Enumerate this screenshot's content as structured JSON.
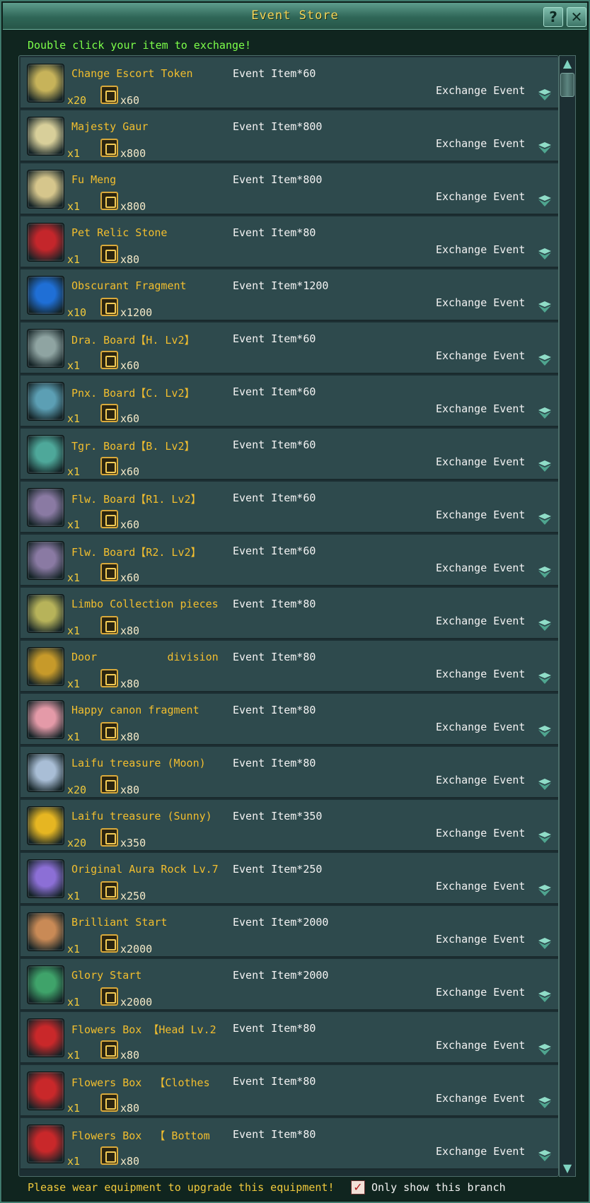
{
  "window": {
    "title": "Event Store",
    "help_label": "?",
    "close_label": "✕"
  },
  "hint": "Double click your item to exchange!",
  "currency_icon": "event-coin-icon",
  "exchange_label": "Exchange Event",
  "items": [
    {
      "name": "Change Escort Token",
      "qty": "x20",
      "price": "x60",
      "cost": "Event Item*60",
      "icon": "escort-token-icon",
      "icon_color": "#c7b35a"
    },
    {
      "name": "Majesty Gaur",
      "qty": "x1",
      "price": "x800",
      "cost": "Event Item*800",
      "icon": "gaur-mount-icon",
      "icon_color": "#d8cf9a"
    },
    {
      "name": "Fu Meng",
      "qty": "x1",
      "price": "x800",
      "cost": "Event Item*800",
      "icon": "fu-meng-mount-icon",
      "icon_color": "#d6c68c"
    },
    {
      "name": "Pet Relic Stone",
      "qty": "x1",
      "price": "x80",
      "cost": "Event Item*80",
      "icon": "relic-stone-icon",
      "icon_color": "#c4262b"
    },
    {
      "name": "Obscurant Fragment",
      "qty": "x10",
      "price": "x1200",
      "cost": "Event Item*1200",
      "icon": "blue-crystal-icon",
      "icon_color": "#1f6fd6"
    },
    {
      "name": "Dra. Board【H. Lv2】",
      "qty": "x1",
      "price": "x60",
      "cost": "Event Item*60",
      "icon": "board-book-icon",
      "icon_color": "#8fa4a2"
    },
    {
      "name": "Pnx. Board【C. Lv2】",
      "qty": "x1",
      "price": "x60",
      "cost": "Event Item*60",
      "icon": "board-book-icon",
      "icon_color": "#5c9fb4"
    },
    {
      "name": "Tgr. Board【B. Lv2】",
      "qty": "x1",
      "price": "x60",
      "cost": "Event Item*60",
      "icon": "board-book-icon",
      "icon_color": "#4ea89a"
    },
    {
      "name": "Flw. Board【R1. Lv2】",
      "qty": "x1",
      "price": "x60",
      "cost": "Event Item*60",
      "icon": "board-book-icon",
      "icon_color": "#8a7aa3"
    },
    {
      "name": "Flw. Board【R2. Lv2】",
      "qty": "x1",
      "price": "x60",
      "cost": "Event Item*60",
      "icon": "board-book-icon",
      "icon_color": "#8a7aa3"
    },
    {
      "name": "Limbo Collection pieces",
      "qty": "x1",
      "price": "x80",
      "cost": "Event Item*80",
      "icon": "leaf-pieces-icon",
      "icon_color": "#b7b35a"
    },
    {
      "name": "Door           division",
      "qty": "x1",
      "price": "x80",
      "cost": "Event Item*80",
      "icon": "golden-scroll-icon",
      "icon_color": "#c79a2a"
    },
    {
      "name": "Happy canon fragment",
      "qty": "x1",
      "price": "x80",
      "cost": "Event Item*80",
      "icon": "pink-fragment-icon",
      "icon_color": "#e49aa8"
    },
    {
      "name": "Laifu treasure (Moon)",
      "qty": "x20",
      "price": "x80",
      "cost": "Event Item*80",
      "icon": "moon-treasure-icon",
      "icon_color": "#a9bed6"
    },
    {
      "name": "Laifu treasure (Sunny)",
      "qty": "x20",
      "price": "x350",
      "cost": "Event Item*350",
      "icon": "sun-treasure-icon",
      "icon_color": "#e6b622"
    },
    {
      "name": "Original Aura Rock Lv.7",
      "qty": "x1",
      "price": "x250",
      "cost": "Event Item*250",
      "icon": "aura-rock-icon",
      "icon_color": "#8c6fd6"
    },
    {
      "name": "Brilliant Start",
      "qty": "x1",
      "price": "x2000",
      "cost": "Event Item*2000",
      "icon": "bronze-ring-icon",
      "icon_color": "#c98a56"
    },
    {
      "name": "Glory Start",
      "qty": "x1",
      "price": "x2000",
      "cost": "Event Item*2000",
      "icon": "green-ring-icon",
      "icon_color": "#3fa36a"
    },
    {
      "name": "Flowers Box 【Head Lv.2",
      "qty": "x1",
      "price": "x80",
      "cost": "Event Item*80",
      "icon": "gift-box-icon",
      "icon_color": "#c9282a"
    },
    {
      "name": "Flowers Box  【Clothes",
      "qty": "x1",
      "price": "x80",
      "cost": "Event Item*80",
      "icon": "gift-box-icon",
      "icon_color": "#c9282a"
    },
    {
      "name": "Flowers Box  【 Bottom",
      "qty": "x1",
      "price": "x80",
      "cost": "Event Item*80",
      "icon": "gift-box-icon",
      "icon_color": "#c9282a"
    }
  ],
  "footer": {
    "note": "Please wear equipment to upgrade this equipment!",
    "checkbox_checked": true,
    "checkbox_mark": "✓",
    "checkbox_label": "Only show this branch"
  },
  "scrollbar": {
    "up_label": "▲",
    "down_label": "▼"
  }
}
